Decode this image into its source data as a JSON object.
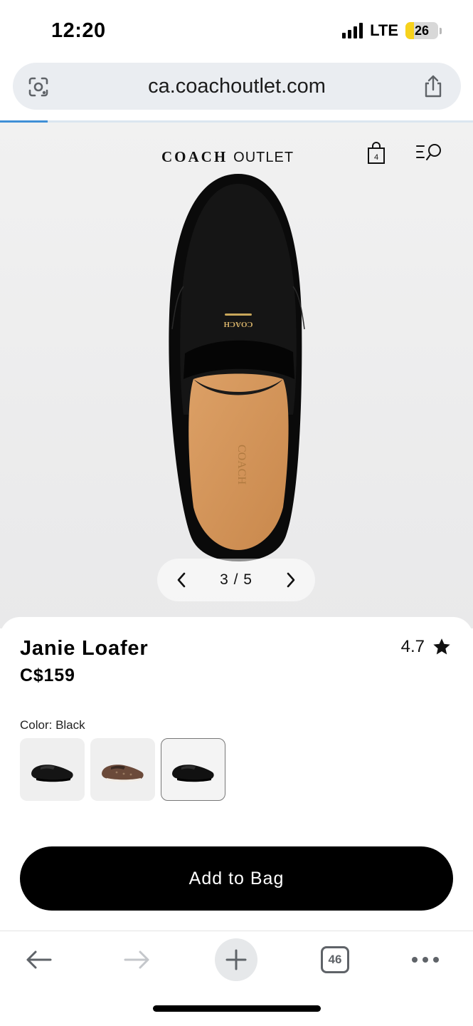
{
  "status_bar": {
    "time": "12:20",
    "network": "LTE",
    "battery_level": "26",
    "battery_percent": 26
  },
  "browser": {
    "url": "ca.coachoutlet.com",
    "load_progress_percent": 10,
    "icons": {
      "lens": "google-lens-icon",
      "share": "share-icon"
    }
  },
  "header": {
    "brand_name": "COACH",
    "brand_suffix": "OUTLET",
    "bag_count": "4",
    "icons": {
      "bag": "shopping-bag-icon",
      "menu_search": "menu-search-icon"
    }
  },
  "gallery": {
    "counter": "3 / 5",
    "current": 3,
    "total": 5
  },
  "product": {
    "name": "Janie Loafer",
    "price": "C$159",
    "rating": "4.7",
    "color_label": "Color: Black",
    "swatches": [
      {
        "name": "black",
        "selected": false
      },
      {
        "name": "signature-brown",
        "selected": false
      },
      {
        "name": "black",
        "selected": true
      }
    ],
    "add_to_bag_label": "Add to Bag"
  },
  "toolbar": {
    "tab_count": "46",
    "icons": [
      "back-icon",
      "forward-icon",
      "new-tab-icon",
      "tabs-icon",
      "more-icon"
    ]
  },
  "colors": {
    "accent_progress": "#3f8fd6",
    "battery_yellow": "#f7d21c",
    "button_black": "#000000"
  }
}
